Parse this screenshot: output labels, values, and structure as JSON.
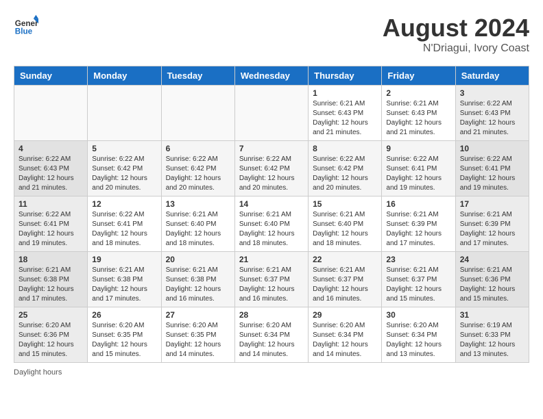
{
  "header": {
    "logo_line1": "General",
    "logo_line2": "Blue",
    "main_title": "August 2024",
    "subtitle": "N'Driagui, Ivory Coast"
  },
  "days_of_week": [
    "Sunday",
    "Monday",
    "Tuesday",
    "Wednesday",
    "Thursday",
    "Friday",
    "Saturday"
  ],
  "weeks": [
    [
      {
        "day": "",
        "info": ""
      },
      {
        "day": "",
        "info": ""
      },
      {
        "day": "",
        "info": ""
      },
      {
        "day": "",
        "info": ""
      },
      {
        "day": "1",
        "info": "Sunrise: 6:21 AM\nSunset: 6:43 PM\nDaylight: 12 hours\nand 21 minutes."
      },
      {
        "day": "2",
        "info": "Sunrise: 6:21 AM\nSunset: 6:43 PM\nDaylight: 12 hours\nand 21 minutes."
      },
      {
        "day": "3",
        "info": "Sunrise: 6:22 AM\nSunset: 6:43 PM\nDaylight: 12 hours\nand 21 minutes."
      }
    ],
    [
      {
        "day": "4",
        "info": "Sunrise: 6:22 AM\nSunset: 6:43 PM\nDaylight: 12 hours\nand 21 minutes."
      },
      {
        "day": "5",
        "info": "Sunrise: 6:22 AM\nSunset: 6:42 PM\nDaylight: 12 hours\nand 20 minutes."
      },
      {
        "day": "6",
        "info": "Sunrise: 6:22 AM\nSunset: 6:42 PM\nDaylight: 12 hours\nand 20 minutes."
      },
      {
        "day": "7",
        "info": "Sunrise: 6:22 AM\nSunset: 6:42 PM\nDaylight: 12 hours\nand 20 minutes."
      },
      {
        "day": "8",
        "info": "Sunrise: 6:22 AM\nSunset: 6:42 PM\nDaylight: 12 hours\nand 20 minutes."
      },
      {
        "day": "9",
        "info": "Sunrise: 6:22 AM\nSunset: 6:41 PM\nDaylight: 12 hours\nand 19 minutes."
      },
      {
        "day": "10",
        "info": "Sunrise: 6:22 AM\nSunset: 6:41 PM\nDaylight: 12 hours\nand 19 minutes."
      }
    ],
    [
      {
        "day": "11",
        "info": "Sunrise: 6:22 AM\nSunset: 6:41 PM\nDaylight: 12 hours\nand 19 minutes."
      },
      {
        "day": "12",
        "info": "Sunrise: 6:22 AM\nSunset: 6:41 PM\nDaylight: 12 hours\nand 18 minutes."
      },
      {
        "day": "13",
        "info": "Sunrise: 6:21 AM\nSunset: 6:40 PM\nDaylight: 12 hours\nand 18 minutes."
      },
      {
        "day": "14",
        "info": "Sunrise: 6:21 AM\nSunset: 6:40 PM\nDaylight: 12 hours\nand 18 minutes."
      },
      {
        "day": "15",
        "info": "Sunrise: 6:21 AM\nSunset: 6:40 PM\nDaylight: 12 hours\nand 18 minutes."
      },
      {
        "day": "16",
        "info": "Sunrise: 6:21 AM\nSunset: 6:39 PM\nDaylight: 12 hours\nand 17 minutes."
      },
      {
        "day": "17",
        "info": "Sunrise: 6:21 AM\nSunset: 6:39 PM\nDaylight: 12 hours\nand 17 minutes."
      }
    ],
    [
      {
        "day": "18",
        "info": "Sunrise: 6:21 AM\nSunset: 6:38 PM\nDaylight: 12 hours\nand 17 minutes."
      },
      {
        "day": "19",
        "info": "Sunrise: 6:21 AM\nSunset: 6:38 PM\nDaylight: 12 hours\nand 17 minutes."
      },
      {
        "day": "20",
        "info": "Sunrise: 6:21 AM\nSunset: 6:38 PM\nDaylight: 12 hours\nand 16 minutes."
      },
      {
        "day": "21",
        "info": "Sunrise: 6:21 AM\nSunset: 6:37 PM\nDaylight: 12 hours\nand 16 minutes."
      },
      {
        "day": "22",
        "info": "Sunrise: 6:21 AM\nSunset: 6:37 PM\nDaylight: 12 hours\nand 16 minutes."
      },
      {
        "day": "23",
        "info": "Sunrise: 6:21 AM\nSunset: 6:37 PM\nDaylight: 12 hours\nand 15 minutes."
      },
      {
        "day": "24",
        "info": "Sunrise: 6:21 AM\nSunset: 6:36 PM\nDaylight: 12 hours\nand 15 minutes."
      }
    ],
    [
      {
        "day": "25",
        "info": "Sunrise: 6:20 AM\nSunset: 6:36 PM\nDaylight: 12 hours\nand 15 minutes."
      },
      {
        "day": "26",
        "info": "Sunrise: 6:20 AM\nSunset: 6:35 PM\nDaylight: 12 hours\nand 15 minutes."
      },
      {
        "day": "27",
        "info": "Sunrise: 6:20 AM\nSunset: 6:35 PM\nDaylight: 12 hours\nand 14 minutes."
      },
      {
        "day": "28",
        "info": "Sunrise: 6:20 AM\nSunset: 6:34 PM\nDaylight: 12 hours\nand 14 minutes."
      },
      {
        "day": "29",
        "info": "Sunrise: 6:20 AM\nSunset: 6:34 PM\nDaylight: 12 hours\nand 14 minutes."
      },
      {
        "day": "30",
        "info": "Sunrise: 6:20 AM\nSunset: 6:34 PM\nDaylight: 12 hours\nand 13 minutes."
      },
      {
        "day": "31",
        "info": "Sunrise: 6:19 AM\nSunset: 6:33 PM\nDaylight: 12 hours\nand 13 minutes."
      }
    ]
  ],
  "footer": {
    "note": "Daylight hours"
  }
}
